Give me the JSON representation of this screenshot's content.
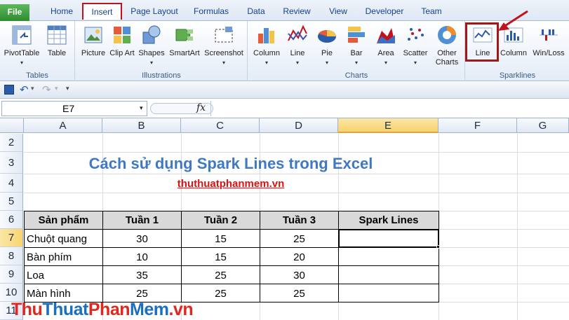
{
  "tabs": [
    "File",
    "Home",
    "Insert",
    "Page Layout",
    "Formulas",
    "Data",
    "Review",
    "View",
    "Developer",
    "Team"
  ],
  "ribbon": {
    "tables": {
      "label": "Tables",
      "buttons": [
        "PivotTable",
        "Table"
      ]
    },
    "illustrations": {
      "label": "Illustrations",
      "buttons": [
        "Picture",
        "Clip Art",
        "Shapes",
        "SmartArt",
        "Screenshot"
      ]
    },
    "charts": {
      "label": "Charts",
      "buttons": [
        "Column",
        "Line",
        "Pie",
        "Bar",
        "Area",
        "Scatter",
        "Other Charts"
      ]
    },
    "sparklines": {
      "label": "Sparklines",
      "buttons": [
        "Line",
        "Column",
        "Win/Loss"
      ]
    }
  },
  "formula_bar": {
    "name_box": "E7",
    "fx": "fx",
    "value": ""
  },
  "columns": [
    "A",
    "B",
    "C",
    "D",
    "E",
    "F",
    "G"
  ],
  "rows": [
    "2",
    "3",
    "4",
    "5",
    "6",
    "7",
    "8",
    "9",
    "10",
    "11"
  ],
  "sheet": {
    "title": "Cách sử dụng Spark Lines trong Excel",
    "site": "thuthuatphanmem.vn",
    "headers": [
      "Sản phẩm",
      "Tuần 1",
      "Tuần 2",
      "Tuần 3",
      "Spark Lines"
    ],
    "data": [
      {
        "name": "Chuột quang",
        "w1": "30",
        "w2": "15",
        "w3": "25"
      },
      {
        "name": "Bàn phím",
        "w1": "10",
        "w2": "15",
        "w3": "20"
      },
      {
        "name": "Loa",
        "w1": "35",
        "w2": "25",
        "w3": "30"
      },
      {
        "name": "Màn hình",
        "w1": "25",
        "w2": "25",
        "w3": "25"
      }
    ]
  },
  "watermark": {
    "thu1": "Thu",
    "thuat": "Thuat",
    "phan": "Phan",
    "mem": "Mem",
    ".vn": ".vn"
  },
  "colors": {
    "accent": "#3f79c3",
    "highlight": "#a01818",
    "title": "#3f79c3",
    "link": "#e01010"
  }
}
